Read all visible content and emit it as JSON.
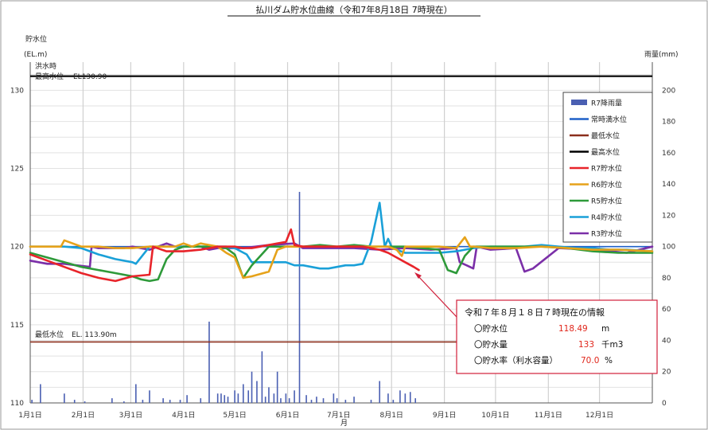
{
  "chart_data": {
    "type": "line",
    "title": "払川ダム貯水位曲線（令和7年8月18日 7時現在）",
    "y_left_label_line1": "貯水位",
    "y_left_label_line2": "(EL.m)",
    "y_right_label": "雨量(mm)",
    "x_axis_label": "月",
    "y_left_ticks": [
      "110",
      "115",
      "120",
      "125",
      "130"
    ],
    "y_right_ticks": [
      "0",
      "20",
      "40",
      "60",
      "80",
      "100",
      "120",
      "140",
      "160",
      "180",
      "200"
    ],
    "x_ticks": [
      "1月1日",
      "2月1日",
      "3月1日",
      "4月1日",
      "5月1日",
      "6月1日",
      "7月1日",
      "8月1日",
      "9月1日",
      "10月1日",
      "11月1日",
      "12月1日"
    ],
    "ylim_left": [
      110,
      131.8
    ],
    "ylim_right": [
      0,
      218
    ],
    "xlim_day": [
      0,
      365
    ],
    "flood_note_line1": "洪水時",
    "flood_note_line2": "最高水位",
    "flood_note_value": "EL130.90",
    "min_note_label": "最低水位",
    "min_note_value": "EL. 113.90m",
    "max_level_value": 130.9,
    "min_level_value": 113.9,
    "normal_level_value": 120.0,
    "legend": [
      {
        "label": "R7降雨量",
        "color": "#4a5fb2",
        "kind": "bar"
      },
      {
        "label": "常時満水位",
        "color": "#1f60c8",
        "kind": "line"
      },
      {
        "label": "最低水位",
        "color": "#8b2f1c",
        "kind": "line"
      },
      {
        "label": "最高水位",
        "color": "#000000",
        "kind": "line"
      },
      {
        "label": "R7貯水位",
        "color": "#e8242a",
        "kind": "line"
      },
      {
        "label": "R6貯水位",
        "color": "#e6a21a",
        "kind": "line"
      },
      {
        "label": "R5貯水位",
        "color": "#2e9a3a",
        "kind": "line"
      },
      {
        "label": "R4貯水位",
        "color": "#1aa0d8",
        "kind": "line"
      },
      {
        "label": "R3貯水位",
        "color": "#7b2fa8",
        "kind": "line"
      }
    ],
    "rainfall_R7": {
      "x": [
        1,
        6,
        20,
        26,
        32,
        48,
        55,
        62,
        66,
        70,
        78,
        82,
        88,
        92,
        100,
        105,
        110,
        112,
        114,
        116,
        120,
        122,
        125,
        128,
        130,
        133,
        136,
        138,
        140,
        143,
        145,
        147,
        150,
        152,
        155,
        158,
        162,
        165,
        168,
        172,
        178,
        180,
        185,
        190,
        200,
        205,
        210,
        213,
        217,
        220,
        223,
        226
      ],
      "values": [
        2,
        12,
        6,
        2,
        1,
        3,
        1,
        12,
        2,
        8,
        3,
        2,
        2,
        5,
        3,
        52,
        6,
        6,
        5,
        4,
        8,
        6,
        12,
        8,
        20,
        14,
        33,
        4,
        10,
        6,
        20,
        3,
        6,
        3,
        8,
        135,
        5,
        2,
        4,
        3,
        6,
        3,
        2,
        4,
        2,
        14,
        6,
        2,
        8,
        6,
        7,
        3
      ]
    },
    "series": [
      {
        "name": "R3貯水位",
        "color": "#7b2fa8",
        "x": [
          0,
          10,
          20,
          35,
          36,
          40,
          55,
          60,
          70,
          80,
          85,
          90,
          100,
          105,
          110,
          125,
          140,
          155,
          160,
          175,
          190,
          205,
          220,
          235,
          250,
          252,
          256,
          260,
          262,
          270,
          285,
          290,
          295,
          310,
          330,
          350,
          365
        ],
        "y": [
          119.1,
          118.9,
          118.9,
          118.7,
          120.0,
          119.9,
          119.9,
          120.0,
          119.8,
          120.2,
          120.0,
          120.0,
          120.0,
          119.8,
          119.9,
          119.9,
          120.1,
          120.2,
          119.9,
          119.9,
          119.9,
          119.8,
          119.9,
          119.8,
          119.9,
          119.0,
          118.8,
          118.6,
          120.0,
          119.8,
          119.9,
          118.4,
          118.6,
          119.9,
          119.8,
          119.6,
          120.0
        ]
      },
      {
        "name": "R4貯水位",
        "color": "#1aa0d8",
        "x": [
          0,
          10,
          20,
          30,
          40,
          50,
          60,
          62,
          70,
          80,
          90,
          98,
          100,
          110,
          115,
          120,
          127,
          130,
          140,
          145,
          150,
          155,
          160,
          165,
          170,
          175,
          180,
          185,
          190,
          195,
          200,
          205,
          208,
          210,
          212,
          215,
          220,
          230,
          240,
          250,
          260,
          270,
          280,
          290,
          300,
          310,
          320,
          330,
          340,
          350,
          365
        ],
        "y": [
          120.0,
          120.0,
          120.0,
          119.9,
          119.5,
          119.2,
          119.0,
          118.9,
          120.0,
          120.0,
          120.0,
          120.0,
          120.0,
          120.0,
          120.0,
          119.9,
          119.5,
          119.0,
          119.0,
          119.0,
          119.0,
          118.8,
          118.8,
          118.7,
          118.6,
          118.6,
          118.7,
          118.8,
          118.8,
          118.9,
          120.3,
          122.8,
          120.0,
          120.5,
          120.0,
          119.8,
          119.6,
          119.6,
          119.6,
          119.7,
          119.9,
          120.0,
          120.0,
          120.0,
          120.1,
          120.0,
          119.9,
          119.9,
          119.8,
          119.8,
          119.7
        ]
      },
      {
        "name": "R5貯水位",
        "color": "#2e9a3a",
        "x": [
          0,
          10,
          20,
          30,
          40,
          50,
          60,
          65,
          70,
          75,
          80,
          85,
          90,
          100,
          110,
          115,
          120,
          125,
          130,
          140,
          150,
          160,
          170,
          180,
          190,
          200,
          210,
          220,
          230,
          240,
          245,
          250,
          255,
          260,
          270,
          285,
          300,
          315,
          330,
          345,
          365
        ],
        "y": [
          119.6,
          119.3,
          119.0,
          118.7,
          118.5,
          118.3,
          118.1,
          117.9,
          117.8,
          117.9,
          119.2,
          119.8,
          120.0,
          120.0,
          120.0,
          119.9,
          119.5,
          118.0,
          118.8,
          120.0,
          120.0,
          120.0,
          120.1,
          120.0,
          120.1,
          120.0,
          120.0,
          120.0,
          119.9,
          119.8,
          118.5,
          118.3,
          119.4,
          120.0,
          120.0,
          120.0,
          120.0,
          119.9,
          119.7,
          119.6,
          119.6
        ]
      },
      {
        "name": "R6貯水位",
        "color": "#e6a21a",
        "x": [
          0,
          10,
          18,
          20,
          30,
          40,
          50,
          60,
          70,
          80,
          85,
          90,
          95,
          100,
          110,
          115,
          120,
          125,
          130,
          140,
          145,
          150,
          160,
          170,
          180,
          190,
          200,
          210,
          215,
          218,
          220,
          230,
          240,
          250,
          255,
          258,
          260,
          270,
          285,
          300,
          315,
          330,
          345,
          365
        ],
        "y": [
          120.0,
          120.0,
          120.0,
          120.4,
          120.0,
          120.0,
          119.9,
          119.9,
          120.0,
          120.0,
          120.0,
          120.2,
          120.0,
          120.2,
          120.0,
          119.6,
          119.3,
          118.0,
          118.1,
          118.4,
          119.8,
          120.0,
          120.0,
          120.0,
          120.0,
          120.0,
          120.0,
          120.0,
          119.8,
          119.4,
          120.0,
          120.0,
          120.0,
          119.9,
          120.6,
          120.0,
          120.0,
          119.9,
          119.9,
          120.0,
          119.9,
          119.8,
          119.8,
          119.7
        ]
      },
      {
        "name": "R7貯水位",
        "color": "#e8242a",
        "x": [
          0,
          10,
          20,
          30,
          40,
          50,
          60,
          70,
          72,
          80,
          90,
          100,
          110,
          115,
          120,
          125,
          130,
          135,
          140,
          145,
          150,
          153,
          155,
          160,
          165,
          170,
          175,
          180,
          185,
          190,
          195,
          200,
          205,
          210,
          215,
          220,
          225,
          228
        ],
        "y": [
          119.5,
          119.1,
          118.7,
          118.3,
          118.0,
          117.8,
          118.1,
          118.2,
          120.0,
          119.7,
          119.7,
          119.8,
          120.0,
          120.0,
          120.0,
          119.9,
          119.9,
          120.0,
          120.1,
          120.2,
          120.3,
          121.1,
          120.1,
          120.0,
          120.0,
          120.0,
          120.0,
          120.0,
          120.0,
          120.0,
          120.0,
          119.9,
          119.8,
          119.6,
          119.3,
          119.0,
          118.7,
          118.5
        ]
      }
    ]
  },
  "info": {
    "title": "令和７年８月１８日７時現在の情報",
    "rows": [
      {
        "label": "〇貯水位",
        "value": "118.49",
        "unit": "m"
      },
      {
        "label": "〇貯水量",
        "value": "133",
        "unit": "千m3"
      },
      {
        "label": "〇貯水率（利水容量）",
        "value": "70.0",
        "unit": "%"
      }
    ]
  },
  "annotation_arrow_target": {
    "day": 228,
    "level": 118.5
  }
}
